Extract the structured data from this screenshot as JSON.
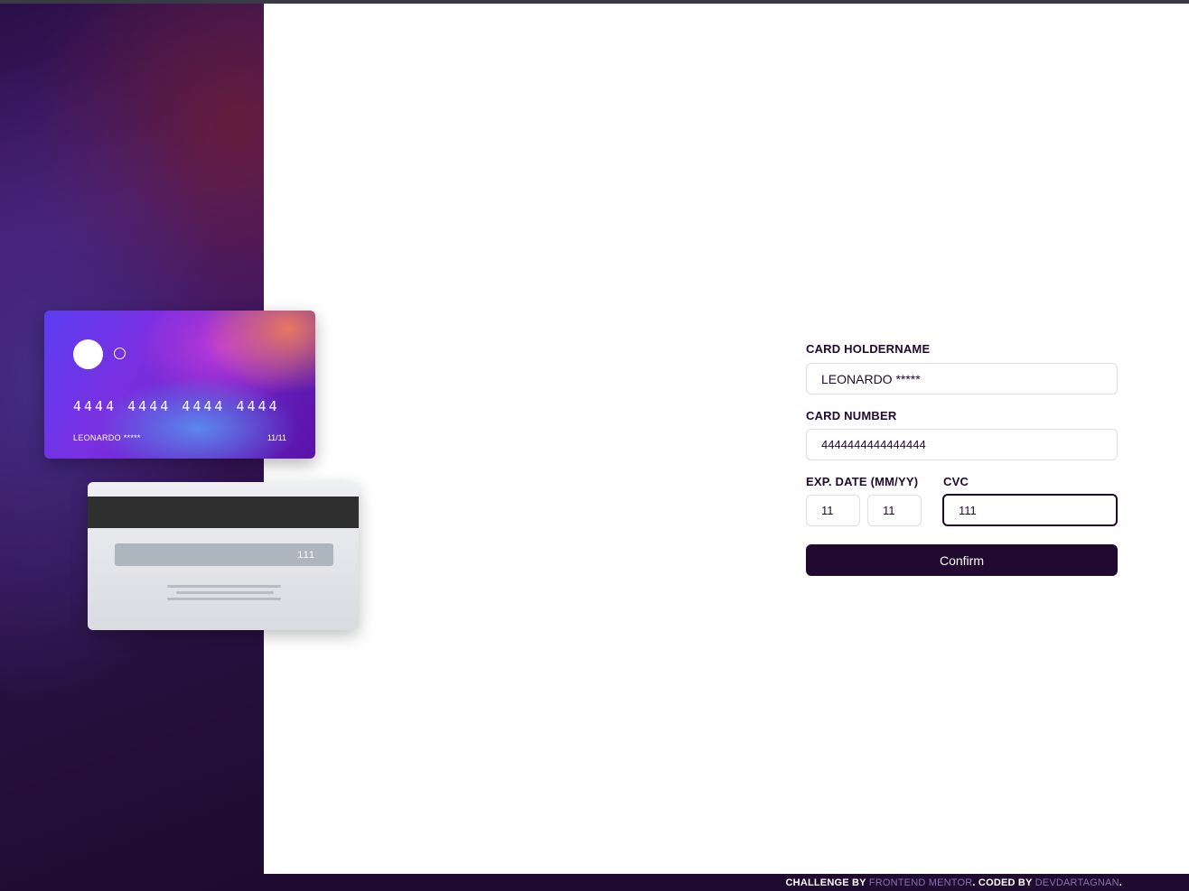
{
  "card_front": {
    "number": "4444 4444 4444 4444",
    "name": "LEONARDO *****",
    "exp": "11/11"
  },
  "card_back": {
    "cvc": "111"
  },
  "form": {
    "name_label": "CARD HOLDERNAME",
    "name_value": "LEONARDO *****",
    "number_label": "CARD NUMBER",
    "number_value": "4444444444444444",
    "exp_label": "EXP. DATE (MM/YY)",
    "exp_month": "11",
    "exp_year": "11",
    "cvc_label": "CVC",
    "cvc_value": "111",
    "confirm_label": "Confirm"
  },
  "footer": {
    "prefix": "CHALLENGE BY ",
    "link1": "FRONTEND MENTOR",
    "middle": ". CODED BY ",
    "link2": "DEVDARTAGNAN",
    "suffix": "."
  },
  "colors": {
    "dark_violet": "#21092f",
    "input_border": "#dfdee0",
    "link": "#8a6fb0"
  },
  "icons": [
    "card-logo-circle-filled",
    "card-logo-circle-outline"
  ]
}
